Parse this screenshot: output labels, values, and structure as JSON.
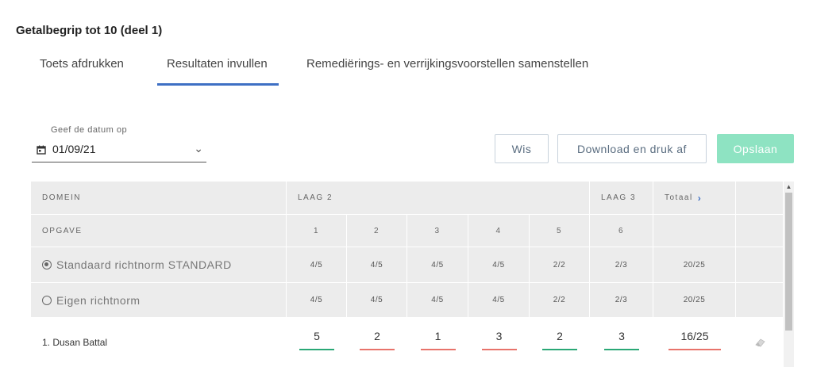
{
  "title": "Getalbegrip tot 10 (deel 1)",
  "tabs": [
    {
      "label": "Toets afdrukken",
      "active": false
    },
    {
      "label": "Resultaten invullen",
      "active": true
    },
    {
      "label": "Remediërings- en verrijkingsvoorstellen samenstellen",
      "active": false
    }
  ],
  "date": {
    "label": "Geef de datum op",
    "value": "01/09/21"
  },
  "buttons": {
    "clear": "Wis",
    "download": "Download en druk af",
    "save": "Opslaan"
  },
  "table": {
    "domain_header": "DOMEIN",
    "layer2": "LAAG 2",
    "layer3": "LAAG 3",
    "total": "Totaal",
    "task_header": "OPGAVE",
    "tasks": [
      "1",
      "2",
      "3",
      "4",
      "5",
      "6"
    ],
    "norms": [
      {
        "label": "Standaard richtnorm STANDARD",
        "selected": true,
        "values": [
          "4/5",
          "4/5",
          "4/5",
          "4/5",
          "2/2",
          "2/3"
        ],
        "total": "20/25"
      },
      {
        "label": "Eigen richtnorm",
        "selected": false,
        "values": [
          "4/5",
          "4/5",
          "4/5",
          "4/5",
          "2/2",
          "2/3"
        ],
        "total": "20/25"
      }
    ],
    "students": [
      {
        "name": "1. Dusan Battal",
        "scores": [
          {
            "value": "5",
            "status": "pass"
          },
          {
            "value": "2",
            "status": "fail"
          },
          {
            "value": "1",
            "status": "fail"
          },
          {
            "value": "3",
            "status": "fail"
          },
          {
            "value": "2",
            "status": "pass"
          },
          {
            "value": "3",
            "status": "pass"
          }
        ],
        "total": {
          "value": "16/25",
          "status": "fail"
        }
      }
    ]
  },
  "colors": {
    "pass": "#2aa876",
    "fail": "#e8736b",
    "accent": "#3e6fc4",
    "save": "#8ee3c2"
  }
}
